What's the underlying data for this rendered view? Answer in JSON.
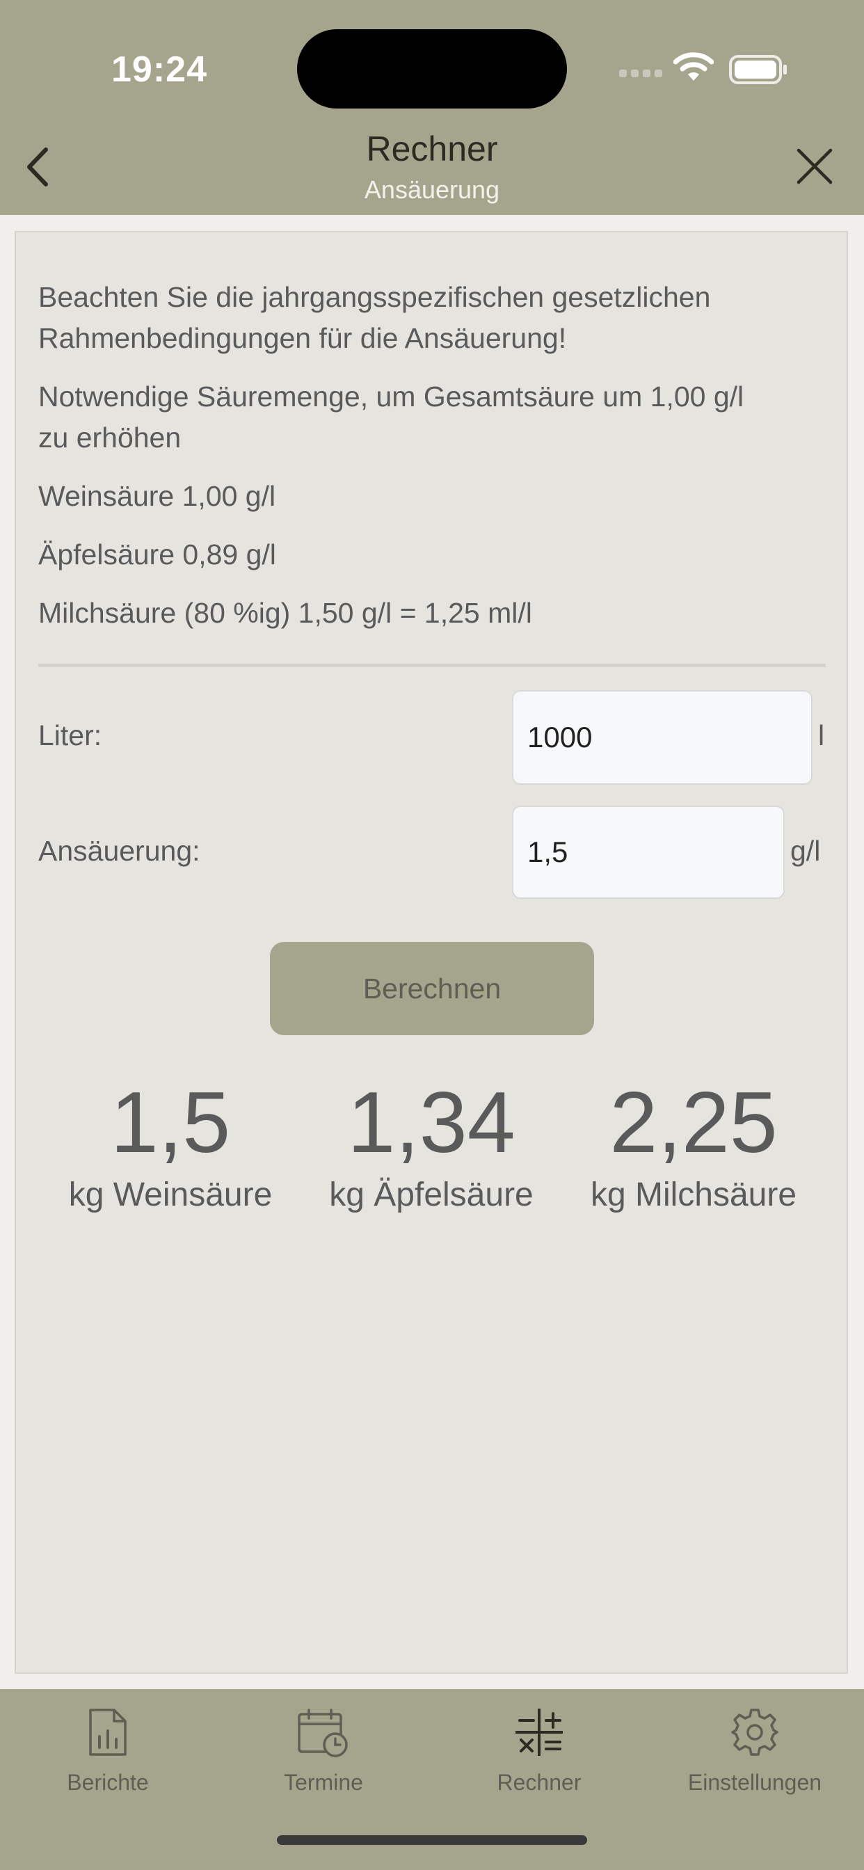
{
  "status_bar": {
    "time": "19:24"
  },
  "nav": {
    "title": "Rechner",
    "subtitle": "Ansäuerung",
    "back_icon": "chevron-left-icon",
    "close_icon": "close-icon"
  },
  "info": {
    "line1": "Beachten Sie die jahrgangsspezifischen gesetzlichen",
    "line2": "Rahmenbedingungen für die Ansäuerung!",
    "line3": "Notwendige Säuremenge, um Gesamtsäure um 1,00 g/l",
    "line4": "zu erhöhen",
    "weinsaeure": "Weinsäure 1,00 g/l",
    "aepfelsaeure": "Äpfelsäure 0,89 g/l",
    "milchsaeure": "Milchsäure (80 %ig) 1,50 g/l = 1,25 ml/l"
  },
  "form": {
    "liter_label": "Liter:",
    "liter_value": "1000",
    "liter_unit": "l",
    "ansaeuerung_label": "Ansäuerung:",
    "ansaeuerung_value": "1,5",
    "ansaeuerung_unit": "g/l",
    "button": "Berechnen"
  },
  "results": [
    {
      "value": "1,5",
      "label": "kg Weinsäure"
    },
    {
      "value": "1,34",
      "label": "kg Äpfelsäure"
    },
    {
      "value": "2,25",
      "label": "kg Milchsäure"
    }
  ],
  "tabs": [
    {
      "label": "Berichte",
      "icon": "report-icon"
    },
    {
      "label": "Termine",
      "icon": "calendar-clock-icon"
    },
    {
      "label": "Rechner",
      "icon": "calculator-icon",
      "active": true
    },
    {
      "label": "Einstellungen",
      "icon": "gear-icon"
    }
  ],
  "colors": {
    "header": "#a5a58e",
    "card": "#e6e4df",
    "background": "#f0efec"
  }
}
